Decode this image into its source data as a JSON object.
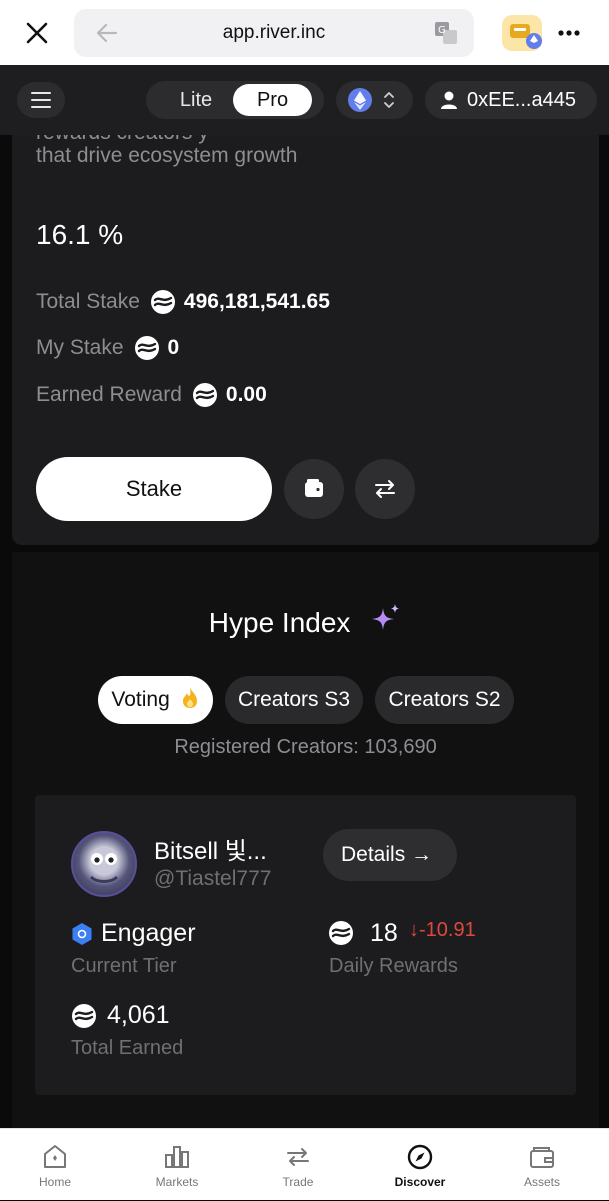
{
  "browser": {
    "url": "app.river.inc"
  },
  "header": {
    "mode_lite": "Lite",
    "mode_pro": "Pro",
    "account": "0xEE...a445"
  },
  "stake_card": {
    "description_cut": "rewards creators y",
    "description": "that drive ecosystem growth",
    "apr": "16.1 %",
    "total_stake_label": "Total Stake",
    "total_stake_value": "496,181,541.65",
    "my_stake_label": "My Stake",
    "my_stake_value": "0",
    "earned_reward_label": "Earned Reward",
    "earned_reward_value": "0.00",
    "stake_button": "Stake"
  },
  "hype": {
    "title": "Hype Index",
    "tabs": [
      {
        "label": "Voting"
      },
      {
        "label": "Creators S3"
      },
      {
        "label": "Creators S2"
      }
    ],
    "registered": "Registered Creators: 103,690",
    "creator": {
      "name": "Bitsell 빛...",
      "handle": "@Tiastel777",
      "details_button": "Details →",
      "tier_value": "Engager",
      "tier_label": "Current Tier",
      "daily_value": "18",
      "daily_change": "↓-10.91",
      "daily_label": "Daily Rewards",
      "total_value": "4,061",
      "total_label": "Total Earned"
    }
  },
  "tabbar": {
    "items": [
      {
        "label": "Home",
        "icon": "home-icon"
      },
      {
        "label": "Markets",
        "icon": "markets-icon"
      },
      {
        "label": "Trade",
        "icon": "trade-icon"
      },
      {
        "label": "Discover",
        "icon": "compass-icon"
      },
      {
        "label": "Assets",
        "icon": "wallet-icon"
      }
    ],
    "active": "Discover"
  },
  "colors": {
    "negative": "#e0483e",
    "ethereum": "#627eea",
    "tier": "#3b7ff5"
  }
}
